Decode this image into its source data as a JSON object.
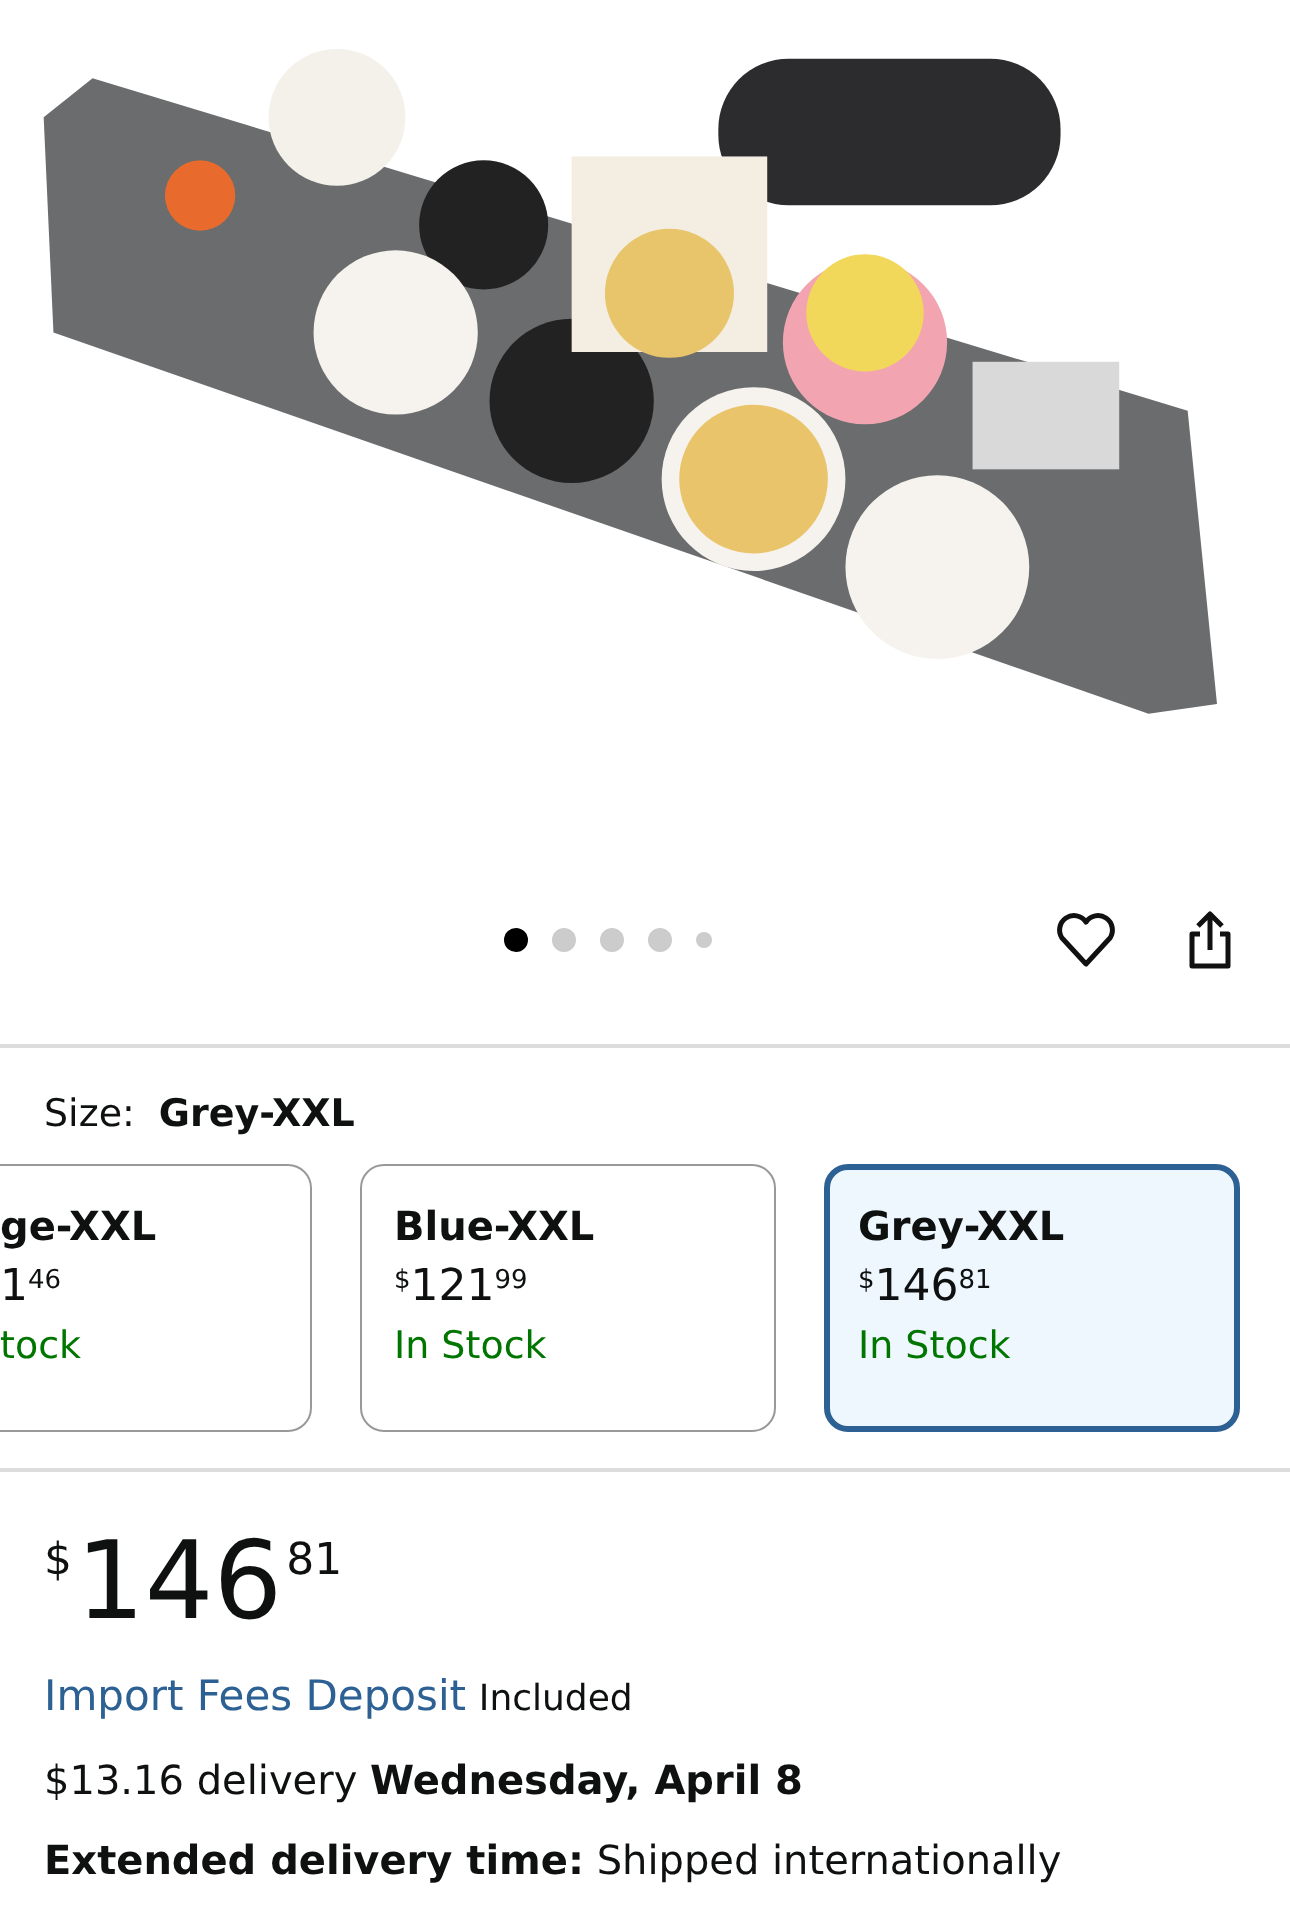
{
  "gallery": {
    "dots": [
      {
        "selected": true
      },
      {
        "selected": false
      },
      {
        "selected": false
      },
      {
        "selected": false
      },
      {
        "selected": false
      }
    ]
  },
  "size": {
    "label": "Size:",
    "value": "Grey-XXL",
    "options": [
      {
        "name": "ge-XXL",
        "whole": "1",
        "fraction": "46",
        "stock": "tock",
        "selected": false,
        "cut": true
      },
      {
        "name": "Blue-XXL",
        "currency": "$",
        "whole": "121",
        "fraction": "99",
        "stock": "In Stock",
        "selected": false,
        "cut": false
      },
      {
        "name": "Grey-XXL",
        "currency": "$",
        "whole": "146",
        "fraction": "81",
        "stock": "In Stock",
        "selected": true,
        "cut": false
      }
    ]
  },
  "price": {
    "currency": "$",
    "whole": "146",
    "fraction": "81"
  },
  "import_fees": {
    "link": "Import Fees Deposit",
    "status": "Included"
  },
  "delivery": "$13.16 delivery **Wednesday, April 8**",
  "extended": "**Extended delivery time:** Shipped internationally"
}
